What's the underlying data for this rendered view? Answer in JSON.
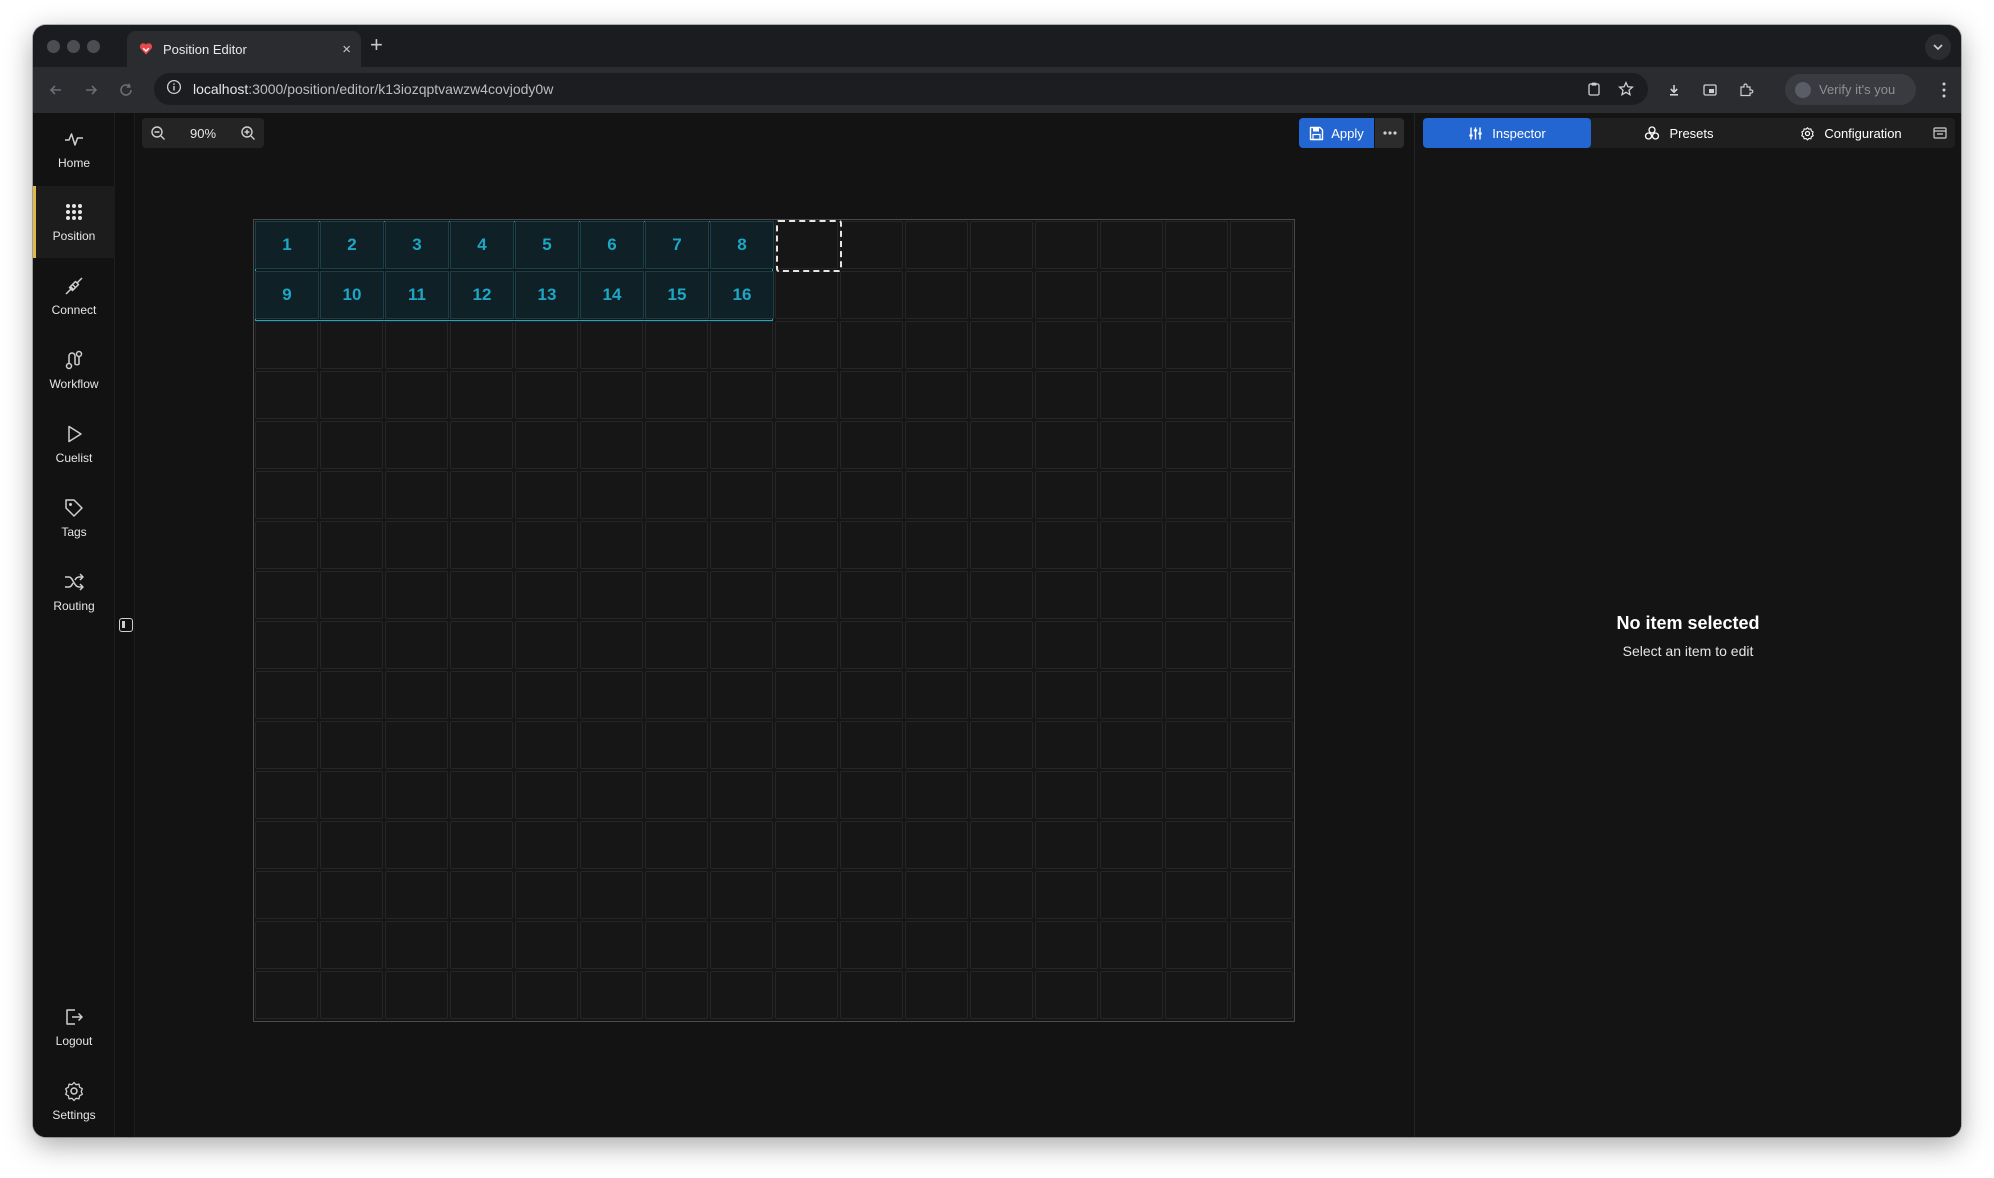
{
  "browser": {
    "tab_title": "Position Editor",
    "new_tab_label": "+",
    "tab_close_label": "×",
    "url_host": "localhost",
    "url_path": ":3000/position/editor/k13iozqptvawzw4covjody0w",
    "profile_label": "Verify it's you"
  },
  "sidebar": {
    "items": [
      {
        "label": "Home",
        "icon": "pulse-icon"
      },
      {
        "label": "Position",
        "icon": "grid-dots-icon",
        "active": true
      },
      {
        "label": "Connect",
        "icon": "plug-icon"
      },
      {
        "label": "Workflow",
        "icon": "workflow-icon"
      },
      {
        "label": "Cuelist",
        "icon": "play-icon"
      },
      {
        "label": "Tags",
        "icon": "tag-icon"
      },
      {
        "label": "Routing",
        "icon": "shuffle-icon"
      }
    ],
    "bottom_items": [
      {
        "label": "Logout",
        "icon": "logout-icon"
      },
      {
        "label": "Settings",
        "icon": "gear-icon"
      }
    ]
  },
  "toolbar": {
    "zoom_value": "90%",
    "apply_label": "Apply"
  },
  "grid": {
    "columns": 16,
    "rows": 16,
    "items": [
      "1",
      "2",
      "3",
      "4",
      "5",
      "6",
      "7",
      "8",
      "9",
      "10",
      "11",
      "12",
      "13",
      "14",
      "15",
      "16"
    ],
    "item_columns": 8
  },
  "inspector": {
    "tabs": [
      {
        "label": "Inspector",
        "icon": "sliders-icon",
        "active": true
      },
      {
        "label": "Presets",
        "icon": "presets-icon"
      },
      {
        "label": "Configuration",
        "icon": "gear-icon"
      }
    ],
    "empty_title": "No item selected",
    "empty_subtitle": "Select an item to edit"
  },
  "colors": {
    "accent_blue": "#2366d1",
    "active_nav_marker": "#e0b84c",
    "item_cyan": "#1ea7c5"
  }
}
